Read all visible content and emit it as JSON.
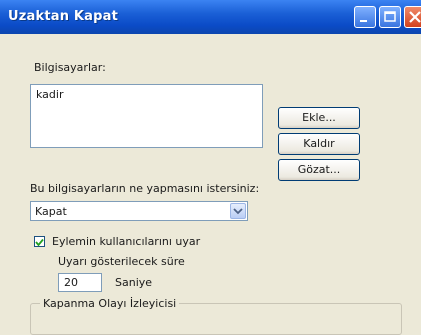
{
  "window": {
    "title": "Uzaktan Kapat"
  },
  "computers": {
    "label": "Bilgisayarlar:",
    "items": [
      "kadir"
    ],
    "add_button": "Ekle...",
    "remove_button": "Kaldır",
    "browse_button": "Gözat..."
  },
  "action": {
    "label": "Bu bilgisayarların ne yapmasını istersiniz:",
    "selected": "Kapat"
  },
  "warn": {
    "checkbox_label": "Eylemin kullanıcılarını uyar",
    "checked": true,
    "duration_label": "Uyarı gösterilecek süre",
    "seconds_value": "20",
    "seconds_unit": "Saniye"
  },
  "event_tracker": {
    "label": "Kapanma Olayı İzleyicisi"
  }
}
